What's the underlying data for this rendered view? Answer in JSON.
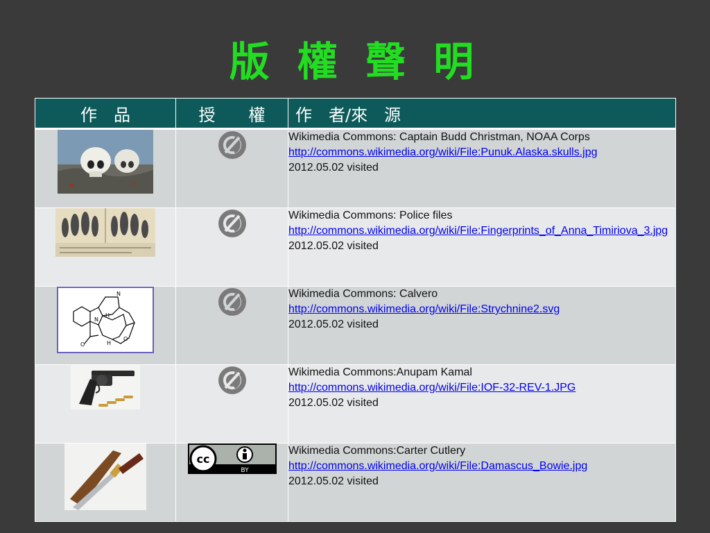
{
  "title": "版 權 聲 明",
  "table": {
    "headers": [
      "作　品",
      "授　　權",
      "作　者/來　源"
    ],
    "rows": [
      {
        "license": "public-domain-icon",
        "author": "Wikimedia Commons: Captain Budd Christman, NOAA Corps",
        "link": "http://commons.wikimedia.org/wiki/File:Punuk.Alaska.skulls.jpg",
        "visited": "2012.05.02 visited"
      },
      {
        "license": "public-domain-icon",
        "author": "Wikimedia Commons: Police files",
        "link": "http://commons.wikimedia.org/wiki/File:Fingerprints_of_Anna_Timiriova_3.jpg",
        "visited": "2012.05.02 visited"
      },
      {
        "license": "public-domain-icon",
        "author": "Wikimedia Commons: Calvero",
        "link": "http://commons.wikimedia.org/wiki/File:Strychnine2.svg",
        "visited": "2012.05.02 visited"
      },
      {
        "license": "public-domain-icon",
        "author": "Wikimedia Commons:Anupam Kamal",
        "link": "http://commons.wikimedia.org/wiki/File:IOF-32-REV-1.JPG",
        "visited": "2012.05.02 visited"
      },
      {
        "license": "cc-by-icon",
        "license_text": "BY",
        "author": "Wikimedia Commons:Carter Cutlery",
        "link": "http://commons.wikimedia.org/wiki/File:Damascus_Bowie.jpg",
        "visited": "2012.05.02 visited"
      }
    ]
  },
  "colors": {
    "title": "#22dd22",
    "header_bg": "#0e5a5a",
    "link": "#0000ee",
    "background": "#3a3a3a"
  }
}
